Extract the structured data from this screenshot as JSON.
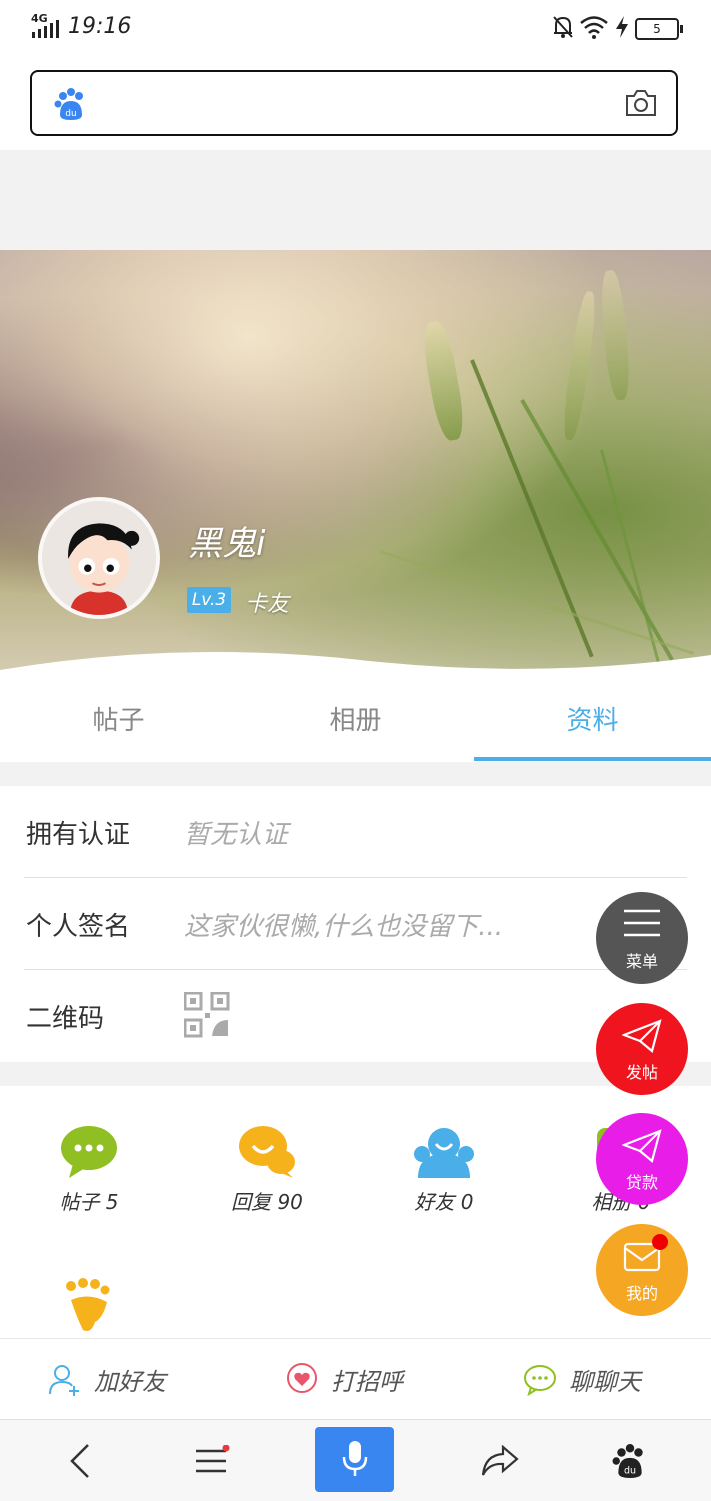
{
  "status_bar": {
    "network": "4G",
    "time": "19:16",
    "battery": "5"
  },
  "profile": {
    "username": "黑鬼i",
    "level": "Lv.3",
    "rank": "卡友"
  },
  "tabs": [
    {
      "label": "帖子"
    },
    {
      "label": "相册"
    },
    {
      "label": "资料",
      "active": true
    }
  ],
  "info": {
    "cert_label": "拥有认证",
    "cert_value": "暂无认证",
    "sign_label": "个人签名",
    "sign_value": "这家伙很懒,什么也没留下...",
    "qr_label": "二维码"
  },
  "stats": [
    {
      "label": "帖子 5",
      "icon": "chat-bubble-icon",
      "color": "#8fbf22"
    },
    {
      "label": "回复 90",
      "icon": "reply-bubbles-icon",
      "color": "#f5b21b"
    },
    {
      "label": "好友 0",
      "icon": "friends-icon",
      "color": "#4aaee8"
    },
    {
      "label": "相册 0",
      "icon": "album-icon",
      "color": "#8fbf22"
    },
    {
      "icon": "footprint-icon",
      "color": "#f5b21b"
    }
  ],
  "actions": {
    "add_friend": "加好友",
    "greet": "打招呼",
    "chat": "聊聊天"
  },
  "floating_menu": {
    "menu": "菜单",
    "post": "发帖",
    "loan": "贷款",
    "mine": "我的"
  },
  "colors": {
    "accent": "#4aaee8",
    "fab_menu": "#555555",
    "fab_post": "#f0141e",
    "fab_loan": "#e81ee8",
    "fab_mine": "#f5a623",
    "mic": "#3a86f0"
  }
}
